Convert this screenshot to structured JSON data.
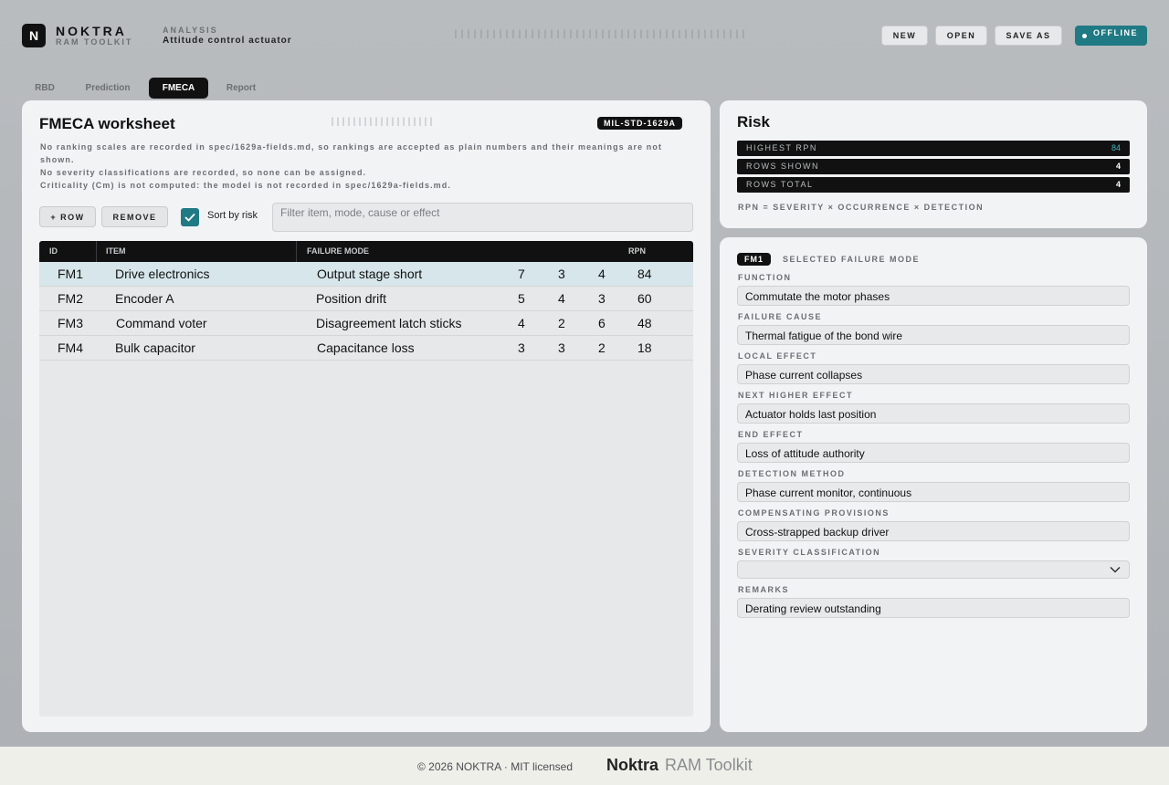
{
  "header": {
    "logo_letter": "N",
    "brand": "NOKTRA",
    "brand_sub": "RAM TOOLKIT",
    "analysis_label": "ANALYSIS",
    "analysis_value": "Attitude control actuator",
    "buttons": {
      "new": "NEW",
      "open": "OPEN",
      "save_as": "SAVE AS"
    },
    "status": "OFFLINE"
  },
  "tabs": [
    {
      "label": "RBD",
      "active": false
    },
    {
      "label": "Prediction",
      "active": false
    },
    {
      "label": "FMECA",
      "active": true
    },
    {
      "label": "Report",
      "active": false
    }
  ],
  "worksheet": {
    "title": "FMECA worksheet",
    "standard": "MIL-STD-1629A",
    "notes": [
      "No ranking scales are recorded in spec/1629a-fields.md, so rankings are accepted as plain numbers and their meanings are not shown.",
      "No severity classifications are recorded, so none can be assigned.",
      "Criticality (Cm) is not computed: the model is not recorded in spec/1629a-fields.md."
    ],
    "add_row": "+ ROW",
    "remove": "REMOVE",
    "sort_label": "Sort by risk",
    "sort_checked": true,
    "filter_placeholder": "Filter item, mode, cause or effect",
    "columns": {
      "id": "ID",
      "item": "ITEM",
      "mode": "FAILURE MODE",
      "rpn": "RPN"
    },
    "rows": [
      {
        "id": "FM1",
        "item": "Drive electronics",
        "mode": "Output stage short",
        "s": "7",
        "o": "3",
        "d": "4",
        "rpn": "84",
        "selected": true
      },
      {
        "id": "FM2",
        "item": "Encoder A",
        "mode": "Position drift",
        "s": "5",
        "o": "4",
        "d": "3",
        "rpn": "60",
        "selected": false
      },
      {
        "id": "FM3",
        "item": "Command voter",
        "mode": "Disagreement latch sticks",
        "s": "4",
        "o": "2",
        "d": "6",
        "rpn": "48",
        "selected": false
      },
      {
        "id": "FM4",
        "item": "Bulk capacitor",
        "mode": "Capacitance loss",
        "s": "3",
        "o": "3",
        "d": "2",
        "rpn": "18",
        "selected": false
      }
    ]
  },
  "risk": {
    "title": "Risk",
    "highest_rpn_label": "HIGHEST RPN",
    "highest_rpn": "84",
    "rows_shown_label": "ROWS SHOWN",
    "rows_shown": "4",
    "rows_total_label": "ROWS TOTAL",
    "rows_total": "4",
    "formula": "RPN = SEVERITY × OCCURRENCE × DETECTION"
  },
  "detail": {
    "tag": "FM1",
    "heading": "SELECTED FAILURE MODE",
    "fields": [
      {
        "label": "FUNCTION",
        "value": "Commutate the motor phases"
      },
      {
        "label": "FAILURE CAUSE",
        "value": "Thermal fatigue of the bond wire"
      },
      {
        "label": "LOCAL EFFECT",
        "value": "Phase current collapses"
      },
      {
        "label": "NEXT HIGHER EFFECT",
        "value": "Actuator holds last position"
      },
      {
        "label": "END EFFECT",
        "value": "Loss of attitude authority"
      },
      {
        "label": "DETECTION METHOD",
        "value": "Phase current monitor, continuous"
      },
      {
        "label": "COMPENSATING PROVISIONS",
        "value": "Cross-strapped backup driver"
      }
    ],
    "severity_label": "SEVERITY CLASSIFICATION",
    "severity_value": "",
    "remarks_label": "REMARKS",
    "remarks_value": "Derating review outstanding"
  },
  "footer": {
    "copyright": "© 2026 NOKTRA · MIT licensed",
    "brand": "Noktra",
    "product": "RAM Toolkit"
  },
  "colors": {
    "accent": "#1f7a84",
    "dark": "#111111",
    "selected_row": "#d6e6ea",
    "rpn_highlight": "#48b3bf"
  }
}
